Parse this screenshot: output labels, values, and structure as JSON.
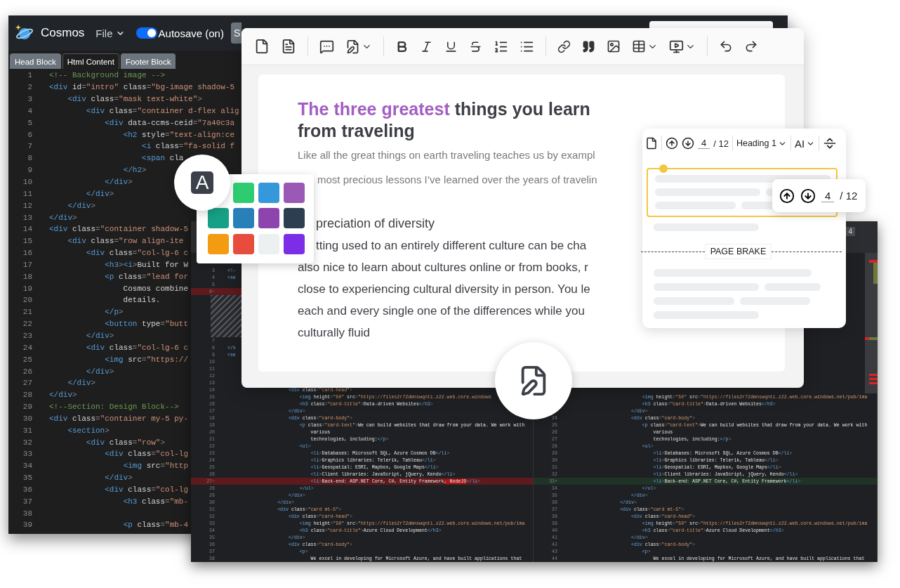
{
  "code_window": {
    "app_name": "Cosmos",
    "file_menu": "File",
    "autosave": {
      "label": "Autosave (on)",
      "on": true
    },
    "cut_button": "S",
    "tabs": [
      {
        "label": "Head Block",
        "selected": false
      },
      {
        "label": "Html Content",
        "selected": true
      },
      {
        "label": "Footer Block",
        "selected": false
      }
    ],
    "lines": [
      {
        "num": "1",
        "kind": "comment",
        "code": "<!-- Background image -->"
      },
      {
        "num": "2",
        "kind": "code",
        "code": "<div id=\"intro\" class=\"bg-image shadow-5"
      },
      {
        "num": "3",
        "kind": "code",
        "code": "    <div class=\"mask text-white\">"
      },
      {
        "num": "4",
        "kind": "code",
        "code": "        <div class=\"container d-flex alig"
      },
      {
        "num": "5",
        "kind": "code",
        "code": "            <div data-ccms-ceid=\"7a40c3a"
      },
      {
        "num": "6",
        "kind": "code",
        "code": "                <h2 style=\"text-align:ce"
      },
      {
        "num": "7",
        "kind": "code",
        "code": "                    <i class=\"fa-solid f"
      },
      {
        "num": "8",
        "kind": "code",
        "code": "                    <span cla"
      },
      {
        "num": "9",
        "kind": "code",
        "code": "                </h2>"
      },
      {
        "num": "10",
        "kind": "code",
        "code": "            </div>"
      },
      {
        "num": "11",
        "kind": "code",
        "code": "        </div>"
      },
      {
        "num": "12",
        "kind": "code",
        "code": "    </div>"
      },
      {
        "num": "13",
        "kind": "code",
        "code": "</div>"
      },
      {
        "num": "14",
        "kind": "code",
        "code": "<div class=\"container shadow-5"
      },
      {
        "num": "15",
        "kind": "code",
        "code": "    <div class=\"row align-ite"
      },
      {
        "num": "16",
        "kind": "code",
        "code": "        <div class=\"col-lg-6 c"
      },
      {
        "num": "17",
        "kind": "code",
        "code": "            <h3><i>Built for W"
      },
      {
        "num": "18",
        "kind": "code",
        "code": "            <p class=\"lead for"
      },
      {
        "num": "19",
        "kind": "code",
        "code": "                Cosmos combine"
      },
      {
        "num": "20",
        "kind": "code",
        "code": "                details."
      },
      {
        "num": "21",
        "kind": "code",
        "code": "            </p>"
      },
      {
        "num": "22",
        "kind": "code",
        "code": "            <button type=\"butt"
      },
      {
        "num": "23",
        "kind": "code",
        "code": "        </div>"
      },
      {
        "num": "24",
        "kind": "code",
        "code": "        <div class=\"col-lg-6 c"
      },
      {
        "num": "25",
        "kind": "code",
        "code": "            <img src=\"https://"
      },
      {
        "num": "26",
        "kind": "code",
        "code": "        </div>"
      },
      {
        "num": "27",
        "kind": "code",
        "code": "    </div>"
      },
      {
        "num": "28",
        "kind": "code",
        "code": "</div>"
      },
      {
        "num": "29",
        "kind": "comment",
        "code": "<!--Section: Design Block-->"
      },
      {
        "num": "30",
        "kind": "code",
        "code": "<div class=\"container my-5 py-"
      },
      {
        "num": "31",
        "kind": "code",
        "code": "    <section>"
      },
      {
        "num": "32",
        "kind": "code",
        "code": "        <div class=\"row\">"
      },
      {
        "num": "33",
        "kind": "code",
        "code": "            <div class=\"col-lg"
      },
      {
        "num": "34",
        "kind": "code",
        "code": "                <img src=\"http"
      },
      {
        "num": "35",
        "kind": "code",
        "code": "            </div>"
      },
      {
        "num": "36",
        "kind": "code",
        "code": "            <div class=\"col-lg"
      },
      {
        "num": "37",
        "kind": "code",
        "code": "                <h3 class=\"mb-"
      },
      {
        "num": "38",
        "kind": "code"
      },
      {
        "num": "39",
        "kind": "code",
        "code": "                <p class=\"mb-4"
      }
    ]
  },
  "diff_window": {
    "header_label": "4",
    "left_rows": [
      {
        "num": "3",
        "kind": "normal",
        "code": "  <!-"
      },
      {
        "num": "4",
        "kind": "normal",
        "code": "  <se"
      },
      {
        "num": "5",
        "kind": "normal"
      },
      {
        "num": "6−",
        "kind": "deleted"
      },
      {
        "kind": "spacer"
      },
      {
        "num": "7",
        "kind": "normal"
      },
      {
        "num": "8",
        "kind": "normal",
        "code": "  </s"
      },
      {
        "num": "9",
        "kind": "normal",
        "code": "  <se"
      },
      {
        "num": "10",
        "kind": "normal"
      },
      {
        "num": "11",
        "kind": "normal"
      },
      {
        "num": "12",
        "kind": "normal"
      },
      {
        "num": "13",
        "kind": "normal"
      },
      {
        "num": "14",
        "kind": "normal",
        "code": "                        <div class=\"card-head\">"
      },
      {
        "num": "15",
        "kind": "normal",
        "code": "                            <img height=\"50\" src=\"https://files2r72dmnswqnti.z22.web.core.windows"
      },
      {
        "num": "16",
        "kind": "normal",
        "code": "                            <h3 class=\"card-title\">Data-driven Websites</h3>"
      },
      {
        "num": "17",
        "kind": "normal",
        "code": "                        </div>"
      },
      {
        "num": "18",
        "kind": "normal",
        "code": "                        <div class=\"card-body\">"
      },
      {
        "num": "19",
        "kind": "normal",
        "code": "                            <p class=\"card-text\">We can build websites that draw from your data. We work with"
      },
      {
        "num": "20",
        "kind": "normal",
        "code": "                                various"
      },
      {
        "num": "21",
        "kind": "normal",
        "code": "                                technologies, including:</p>"
      },
      {
        "num": "22",
        "kind": "normal",
        "code": "                            <ul>"
      },
      {
        "num": "23",
        "kind": "normal",
        "code": "                                <li>Databases: Microsoft SQL, Azure Cosmos DB</li>"
      },
      {
        "num": "24",
        "kind": "normal",
        "code": "                                <li>Graphics libraries: Telerik, Tableau</li>"
      },
      {
        "num": "25",
        "kind": "normal",
        "code": "                                <li>Geospatial: ESRI, Mapbox, Google Maps</li>"
      },
      {
        "num": "26",
        "kind": "normal",
        "code": "                                <li>Client libraries: JavaScript, jQuery, Kendo</li>"
      },
      {
        "num": "27−",
        "kind": "deleted",
        "code": "                                <li>Back-end: ASP.NET Core, C#, Entity Framework",
        "changed": ", NodeJS",
        "tail": "</li>"
      },
      {
        "num": "28",
        "kind": "normal",
        "code": "                            </ul>"
      },
      {
        "num": "29",
        "kind": "normal",
        "code": "                        </div>"
      },
      {
        "num": "30",
        "kind": "normal",
        "code": "                    </div>"
      },
      {
        "num": "31",
        "kind": "normal",
        "code": "                    <div class=\"card mt-5\">"
      },
      {
        "num": "32",
        "kind": "normal",
        "code": "                        <div class=\"card-head\">"
      },
      {
        "num": "33",
        "kind": "normal",
        "code": "                            <img height=\"50\" src=\"https://files2r72dmnswqnti.z22.web.core.windows.net/pub/ima"
      },
      {
        "num": "34",
        "kind": "normal",
        "code": "                            <h3 class=\"card-title\">Azure Cloud Development</h3>"
      },
      {
        "num": "35",
        "kind": "normal",
        "code": "                        </div>"
      },
      {
        "num": "36",
        "kind": "normal",
        "code": "                        <div class=\"card-body\">"
      },
      {
        "num": "37",
        "kind": "normal",
        "code": "                            <p>"
      },
      {
        "num": "38",
        "kind": "normal",
        "code": "                                We excel in developing for Microsoft Azure, and have built applications that"
      }
    ],
    "right_rows": [
      {
        "kind": "normal",
        "code": "                            <img height=\"50\" src=\"https://files2r72dmnswqnti.z22.web.core.windows.net/pub/ima"
      },
      {
        "kind": "normal",
        "code": "                            <h3 class=\"card-title\">Data-driven Websites</h3>"
      },
      {
        "kind": "normal",
        "code": "                        </div>"
      },
      {
        "num": "24",
        "kind": "normal",
        "code": "                        <div class=\"card-body\">"
      },
      {
        "num": "25",
        "kind": "normal",
        "code": "                            <p class=\"card-text\">We can build websites that draw from your data. We work with"
      },
      {
        "num": "26",
        "kind": "normal",
        "code": "                                various"
      },
      {
        "num": "27",
        "kind": "normal",
        "code": "                                technologies, including:</p>"
      },
      {
        "num": "28",
        "kind": "normal",
        "code": "                            <ul>"
      },
      {
        "num": "29",
        "kind": "normal",
        "code": "                                <li>Databases: Microsoft SQL, Azure Cosmos DB</li>"
      },
      {
        "num": "30",
        "kind": "normal",
        "code": "                                <li>Graphics libraries: Telerik, Tableau</li>"
      },
      {
        "num": "31",
        "kind": "normal",
        "code": "                                <li>Geospatial: ESRI, Mapbox, Google Maps</li>"
      },
      {
        "num": "32",
        "kind": "normal",
        "code": "                                <li>Client libraries: JavaScript, jQuery, Kendo</li>"
      },
      {
        "num": "33+",
        "kind": "added",
        "code": "                                <li>Back-end: ASP.NET Core, C#, Entity Framework</li>"
      },
      {
        "num": "34",
        "kind": "normal",
        "code": "                            </ul>"
      },
      {
        "num": "35",
        "kind": "normal",
        "code": "                        </div>"
      },
      {
        "num": "36",
        "kind": "normal",
        "code": "                    </div>"
      },
      {
        "num": "37",
        "kind": "normal",
        "code": "                    <div class=\"card mt-5\">"
      },
      {
        "num": "38",
        "kind": "normal",
        "code": "                        <div class=\"card-head\">"
      },
      {
        "num": "39",
        "kind": "normal",
        "code": "                            <img height=\"50\" src=\"https://files2r72dmnswqnti.z22.web.core.windows.net/pub/ima"
      },
      {
        "num": "40",
        "kind": "normal",
        "code": "                            <h3 class=\"card-title\">Azure Cloud Development</h3>"
      },
      {
        "num": "41",
        "kind": "normal",
        "code": "                        </div>"
      },
      {
        "num": "42",
        "kind": "normal",
        "code": "                        <div class=\"card-body\">"
      },
      {
        "num": "43",
        "kind": "normal",
        "code": "                            <p>"
      },
      {
        "num": "44",
        "kind": "normal",
        "code": "                                We excel in developing for Microsoft Azure, and have built applications that"
      }
    ]
  },
  "document": {
    "title_highlight": "The three greatest",
    "title_rest": "things you learn from traveling",
    "lead_lines": [
      {
        "text": "Like all the great things on earth traveling teaches us by exampl",
        "clipped_start": false
      },
      {
        "text": "most precious lessons I’ve learned over the years of travelin",
        "clipped_start": true
      }
    ],
    "body_heading": "preciation of diversity",
    "body_lines": [
      {
        "text": "tting used to an entirely different culture can be cha",
        "clipped_start": true
      },
      {
        "text": "also nice to learn about cultures online or from books, r",
        "clipped_start": false
      },
      {
        "text": "close to experiencing cultural diversity in person. You le",
        "clipped_start": false
      },
      {
        "text": "each and every single one of the differences while you",
        "clipped_start": false
      },
      {
        "text": "culturally fluid",
        "clipped_start": false
      }
    ]
  },
  "page_panel": {
    "page": "4",
    "total": "/ 12",
    "style": "Heading 1",
    "font_size": "AI",
    "page_break": "PAGE BRAKE"
  },
  "page_popup": {
    "page": "4",
    "total": "/ 12"
  },
  "color_picker": {
    "badge": "A",
    "swatches": [
      {
        "color": "#2ecc71"
      },
      {
        "color": "#3498db"
      },
      {
        "color": "#9b59b6"
      },
      {
        "color": "#16a085"
      },
      {
        "color": "#2980b9"
      },
      {
        "color": "#8e44ad"
      },
      {
        "color": "#2c3e50"
      },
      {
        "color": "#f39c12"
      },
      {
        "color": "#e74c3c"
      },
      {
        "color": "#ecf0f1"
      },
      {
        "color": "#7c2ee6"
      }
    ]
  }
}
